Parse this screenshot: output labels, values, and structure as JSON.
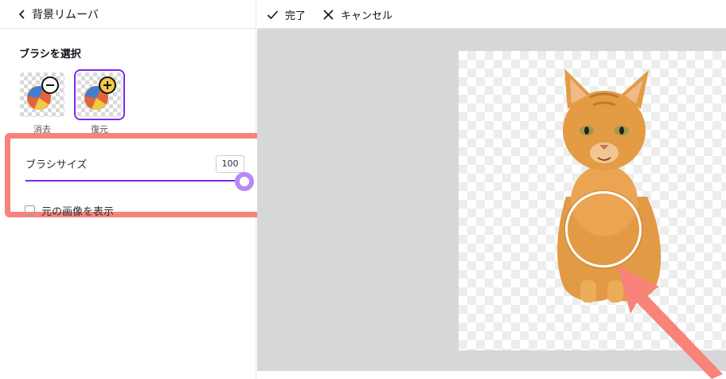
{
  "panel": {
    "back_icon": "chevron-left-icon",
    "title": "背景リムーバ",
    "brush_section_title": "ブラシを選択",
    "brushes": [
      {
        "label": "消去",
        "icon": "minus-icon",
        "selected": false
      },
      {
        "label": "復元",
        "icon": "plus-icon",
        "selected": true
      }
    ],
    "brush_size_label": "ブラシサイズ",
    "brush_size_value": "100",
    "brush_size_level": 1.0,
    "show_original_label": "元の画像を表示"
  },
  "toolbar": {
    "done_label": "完了",
    "done_icon": "check-icon",
    "cancel_label": "キャンセル",
    "cancel_icon": "close-icon"
  },
  "colors": {
    "accent": "#7d2ae8",
    "highlight": "#f7837a",
    "canvas_bg": "#d6d7d8"
  }
}
